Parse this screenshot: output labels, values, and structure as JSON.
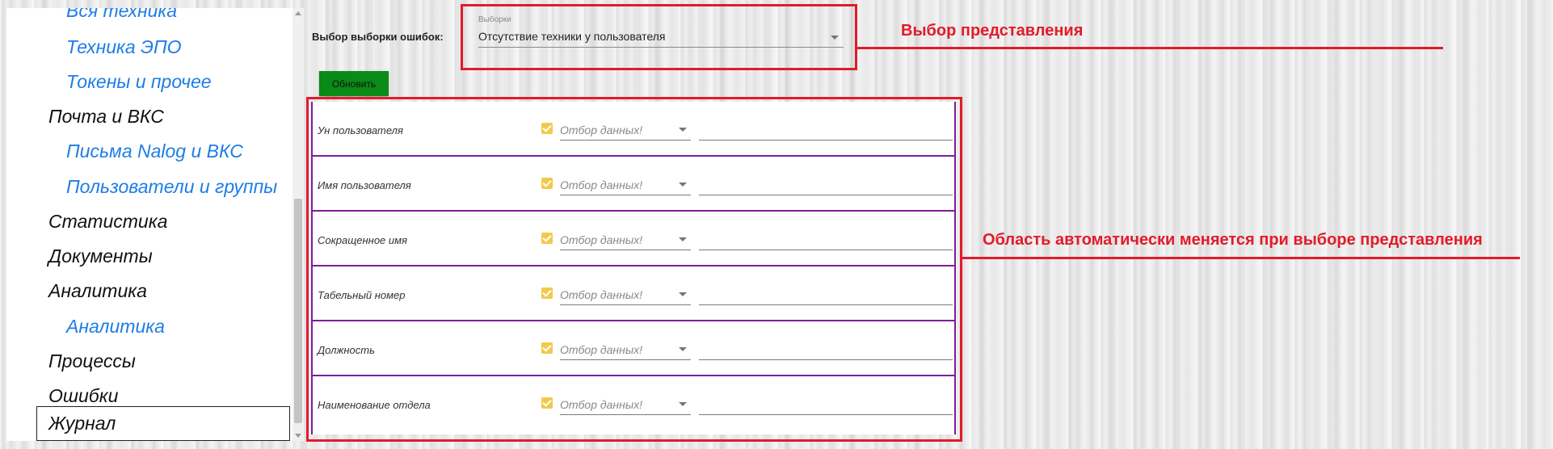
{
  "sidebar": {
    "items": [
      {
        "label": "Вся техника",
        "level": "sub"
      },
      {
        "label": "Техника ЭПО",
        "level": "sub"
      },
      {
        "label": "Токены и прочее",
        "level": "sub"
      },
      {
        "label": "Почта и ВКС",
        "level": "top"
      },
      {
        "label": "Письма Nalog и ВКС",
        "level": "sub"
      },
      {
        "label": "Пользователи и группы",
        "level": "sub"
      },
      {
        "label": "Статистика",
        "level": "top"
      },
      {
        "label": "Документы",
        "level": "top"
      },
      {
        "label": "Аналитика",
        "level": "top"
      },
      {
        "label": "Аналитика",
        "level": "sub"
      },
      {
        "label": "Процессы",
        "level": "top"
      },
      {
        "label": "Ошибки",
        "level": "top"
      },
      {
        "label": "Журнал",
        "level": "top",
        "active": true
      }
    ]
  },
  "selection": {
    "label": "Выбор выборки ошибок:",
    "select_caption": "Выборки",
    "select_value": "Отсутствие техники у пользователя"
  },
  "refresh_button": "Обновить",
  "filter_rows": [
    {
      "label": "Ун пользователя",
      "filter_select": "Отбор данных!",
      "value": ""
    },
    {
      "label": "Имя пользователя",
      "filter_select": "Отбор данных!",
      "value": ""
    },
    {
      "label": "Сокращенное имя",
      "filter_select": "Отбор данных!",
      "value": ""
    },
    {
      "label": "Табельный номер",
      "filter_select": "Отбор данных!",
      "value": ""
    },
    {
      "label": "Должность",
      "filter_select": "Отбор данных!",
      "value": ""
    },
    {
      "label": "Наименование отдела",
      "filter_select": "Отбор данных!",
      "value": ""
    }
  ],
  "annotations": {
    "view_select": "Выбор представления",
    "filter_area": "Область автоматически меняется при выборе представления"
  },
  "colors": {
    "annotation_red": "#e21b2a",
    "link_blue": "#1e7de6",
    "refresh_green": "#0a8a16",
    "row_border_purple": "#7a1f9a",
    "checkbox_yellow": "#f2c94c"
  }
}
